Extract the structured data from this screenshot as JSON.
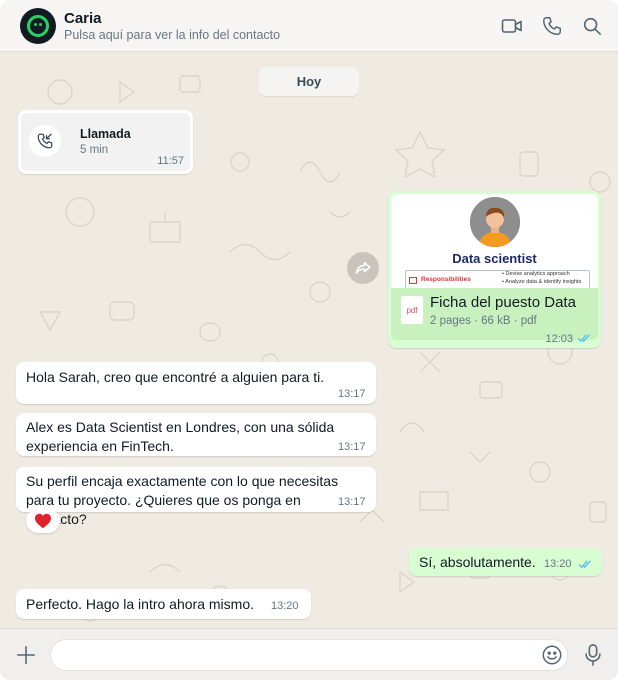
{
  "header": {
    "contact_name": "Caria",
    "subtitle": "Pulsa aquí para ver la info del contacto",
    "icons": [
      "video-icon",
      "phone-icon",
      "search-icon"
    ]
  },
  "chat": {
    "day_label": "Hoy",
    "call": {
      "title": "Llamada",
      "duration": "5 min",
      "time": "11:57"
    },
    "document": {
      "preview_title": "Data scientist",
      "preview_section": "Responsibilities",
      "preview_bullets": [
        "Devise analytics approach",
        "Analyze data & identify insights"
      ],
      "file_name": "Ficha del puesto Data",
      "file_type_badge": "pdf",
      "meta": "2 pages · 66 kB · pdf",
      "time": "12:03"
    },
    "messages": [
      {
        "direction": "in",
        "text": "Hola Sarah, creo que encontré a alguien para ti.",
        "time": "13:17"
      },
      {
        "direction": "in",
        "text": "Alex es Data Scientist en Londres, con una sólida experiencia en FinTech.",
        "time": "13:17"
      },
      {
        "direction": "in",
        "text": "Su perfil encaja exactamente con lo que necesitas para tu proyecto. ¿Quieres que os ponga en contacto?",
        "time": "13:17",
        "reaction": "❤️"
      },
      {
        "direction": "out",
        "text": "Sí, absolutamente.",
        "time": "13:20"
      },
      {
        "direction": "in",
        "text": "Perfecto. Hago la intro ahora mismo.",
        "time": "13:20"
      }
    ]
  },
  "composer": {
    "value": "",
    "icons": [
      "plus-icon",
      "emoji-icon",
      "microphone-icon"
    ]
  },
  "colors": {
    "incoming": "#ffffff",
    "outgoing": "#d9fdd3",
    "accent": "#25d366",
    "read_ticks": "#53bdeb",
    "background": "#efeae2"
  }
}
